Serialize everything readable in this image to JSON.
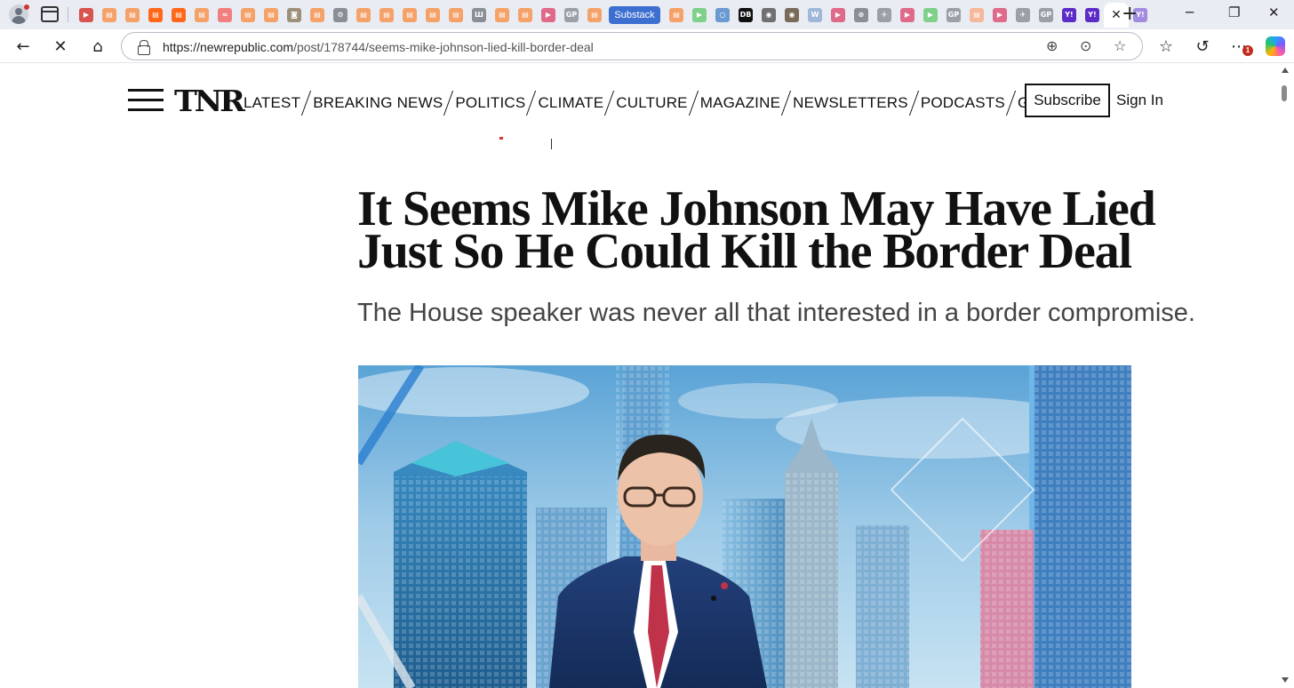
{
  "browser": {
    "tabs_group_label": "Substack",
    "url_host": "https://newrepublic.com",
    "url_path": "/post/178744/seems-mike-johnson-lied-kill-border-deal",
    "extensions_badge": "1",
    "favicons": [
      {
        "color": "#d9534f",
        "glyph": "▶"
      },
      {
        "color": "#f5a26a",
        "glyph": "▤"
      },
      {
        "color": "#f5a26a",
        "glyph": "▤"
      },
      {
        "color": "#ff6719",
        "glyph": "▤"
      },
      {
        "color": "#ff6719",
        "glyph": "▤"
      },
      {
        "color": "#f5a26a",
        "glyph": "▤"
      },
      {
        "color": "#f08080",
        "glyph": "≈"
      },
      {
        "color": "#f5a26a",
        "glyph": "▤"
      },
      {
        "color": "#f5a26a",
        "glyph": "▤"
      },
      {
        "color": "#9e8f7a",
        "glyph": "◙"
      },
      {
        "color": "#f5a26a",
        "glyph": "▤"
      },
      {
        "color": "#8a8f96",
        "glyph": "⚙"
      },
      {
        "color": "#f5a26a",
        "glyph": "▤"
      },
      {
        "color": "#f5a26a",
        "glyph": "▤"
      },
      {
        "color": "#f5a26a",
        "glyph": "▤"
      },
      {
        "color": "#f5a26a",
        "glyph": "▤"
      },
      {
        "color": "#f5a26a",
        "glyph": "▤"
      },
      {
        "color": "#8a8f96",
        "glyph": "Ш"
      },
      {
        "color": "#f5a26a",
        "glyph": "▤"
      },
      {
        "color": "#f5a26a",
        "glyph": "▤"
      },
      {
        "color": "#e06a8a",
        "glyph": "▶"
      },
      {
        "color": "#9aa0a6",
        "glyph": "GP"
      },
      {
        "color": "#f5a26a",
        "glyph": "▤"
      }
    ],
    "favicons_after_group": [
      {
        "color": "#f5a26a",
        "glyph": "▤"
      },
      {
        "color": "#7fd08a",
        "glyph": "▶"
      },
      {
        "color": "#6a9ad0",
        "glyph": "○"
      },
      {
        "color": "#111111",
        "glyph": "DB"
      },
      {
        "color": "#707070",
        "glyph": "◉"
      },
      {
        "color": "#7a6a5a",
        "glyph": "◉"
      },
      {
        "color": "#9fb7d8",
        "glyph": "W"
      },
      {
        "color": "#e06a8a",
        "glyph": "▶"
      },
      {
        "color": "#8a8f96",
        "glyph": "⊚"
      },
      {
        "color": "#9aa0a6",
        "glyph": "✈"
      },
      {
        "color": "#e06a8a",
        "glyph": "▶"
      },
      {
        "color": "#7fd08a",
        "glyph": "▶"
      },
      {
        "color": "#9aa0a6",
        "glyph": "GP"
      },
      {
        "color": "#f5b89a",
        "glyph": "▤"
      },
      {
        "color": "#e06a8a",
        "glyph": "▶"
      },
      {
        "color": "#9aa0a6",
        "glyph": "✈"
      },
      {
        "color": "#9aa0a6",
        "glyph": "GP"
      },
      {
        "color": "#5b2cc6",
        "glyph": "Y!"
      },
      {
        "color": "#5b2cc6",
        "glyph": "Y!"
      }
    ],
    "favicon_after_active": {
      "color": "#a38be0",
      "glyph": "Y!"
    }
  },
  "site": {
    "logo": "TNR",
    "nav": [
      "LATEST",
      "BREAKING NEWS",
      "POLITICS",
      "CLIMATE",
      "CULTURE",
      "MAGAZINE",
      "NEWSLETTERS",
      "PODCASTS",
      "GAMES"
    ],
    "subscribe_label": "Subscribe",
    "signin_label": "Sign In"
  },
  "article": {
    "headline": "It Seems Mike Johnson May Have Lied Just So He Could Kill the Border Deal",
    "dek": "The House speaker was never all that interested in a border compromise."
  }
}
